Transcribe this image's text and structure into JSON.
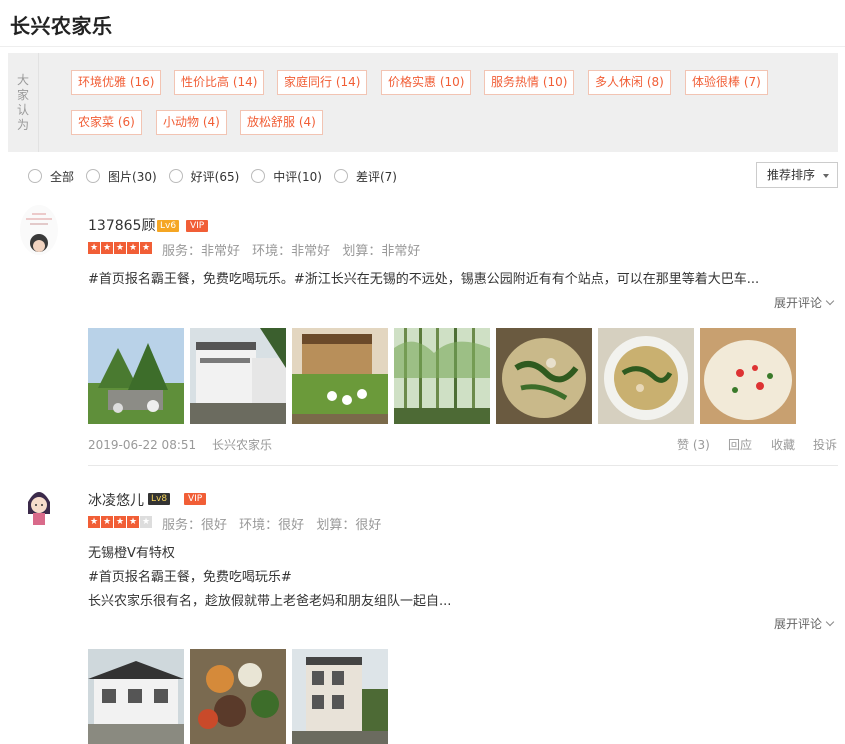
{
  "page": {
    "title": "长兴农家乐"
  },
  "tags": {
    "label": [
      "大",
      "家",
      "认",
      "为"
    ],
    "items": [
      "环境优雅 (16)",
      "性价比高 (14)",
      "家庭同行 (14)",
      "价格实惠 (10)",
      "服务热情 (10)",
      "多人休闲 (8)",
      "体验很棒 (7)",
      "农家菜 (6)",
      "小动物 (4)",
      "放松舒服 (4)"
    ]
  },
  "filters": {
    "items": [
      "全部",
      "图片(30)",
      "好评(65)",
      "中评(10)",
      "差评(7)"
    ],
    "sort_label": "推荐排序"
  },
  "colors": {
    "accent": "#f15e36",
    "lv6": "#f5a623",
    "lv8": "#333333"
  },
  "reviews": [
    {
      "user": "137865顾",
      "level": "Lv6",
      "vip": "VIP",
      "rating": 5,
      "scores": [
        "服务：非常好",
        "环境：非常好",
        "划算：非常好"
      ],
      "text": "#首页报名霸王餐，免费吃喝玩乐。#浙江长兴在无锡的不远处，锡惠公园附近有有个站点，可以在那里等着大巴车...",
      "expand": "展开评论",
      "date": "2019-06-22 08:51",
      "shop": "长兴农家乐",
      "actions": [
        "赞 (3)",
        "回应",
        "收藏",
        "投诉"
      ]
    },
    {
      "user": "冰凌悠儿",
      "level": "Lv8",
      "vip": "VIP",
      "rating": 4,
      "scores": [
        "服务：很好",
        "环境：很好",
        "划算：很好"
      ],
      "lines": [
        "无锡橙V有特权",
        "#首页报名霸王餐，免费吃喝玩乐#",
        "长兴农家乐很有名，趁放假就带上老爸老妈和朋友组队一起自..."
      ],
      "expand": "展开评论"
    }
  ]
}
